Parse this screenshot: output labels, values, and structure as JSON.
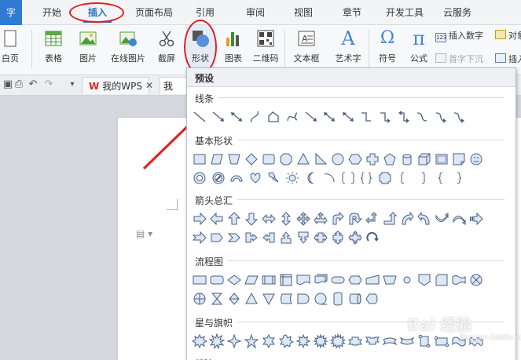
{
  "menubar": {
    "app_label": "字",
    "tabs": [
      {
        "label": "开始"
      },
      {
        "label": "插入"
      },
      {
        "label": "页面布局"
      },
      {
        "label": "引用"
      },
      {
        "label": "审阅"
      },
      {
        "label": "视图"
      },
      {
        "label": "章节"
      },
      {
        "label": "开发工具"
      },
      {
        "label": "云服务"
      }
    ],
    "active_tab": "插入"
  },
  "ribbon": {
    "cover_page": "白页",
    "table": "表格",
    "picture": "图片",
    "online_picture": "在线图片",
    "screenshot": "截屏",
    "shapes": "形状",
    "chart": "图表",
    "qrcode": "二维码",
    "textbox": "文本框",
    "wordart": "艺术字",
    "symbol": "符号",
    "formula": "公式",
    "insert_number": "插入数字",
    "drop_cap": "首字下沉",
    "align": "对象",
    "insert_more": "插入",
    "number_badge": "123",
    "symbol_glyph": "Ω",
    "formula_glyph": "π",
    "wordart_glyph": "A"
  },
  "tabbar": {
    "doc_tab": "我的WPS",
    "doc_tab_logo": "W",
    "second_tab": "我"
  },
  "panel": {
    "title": "预设",
    "sections": {
      "lines": "线条",
      "basic": "基本形状",
      "arrows": "箭头总汇",
      "flowchart": "流程图",
      "stars": "星与旗帜",
      "callouts": "标注"
    }
  },
  "watermark": {
    "text": "Bai 经验",
    "sub": "jingyan.baidu.com"
  },
  "colors": {
    "accent": "#2f6fc0",
    "annotation_red": "#e02020",
    "shape_fill": "#dde8f6",
    "shape_stroke": "#4a5f7e"
  }
}
